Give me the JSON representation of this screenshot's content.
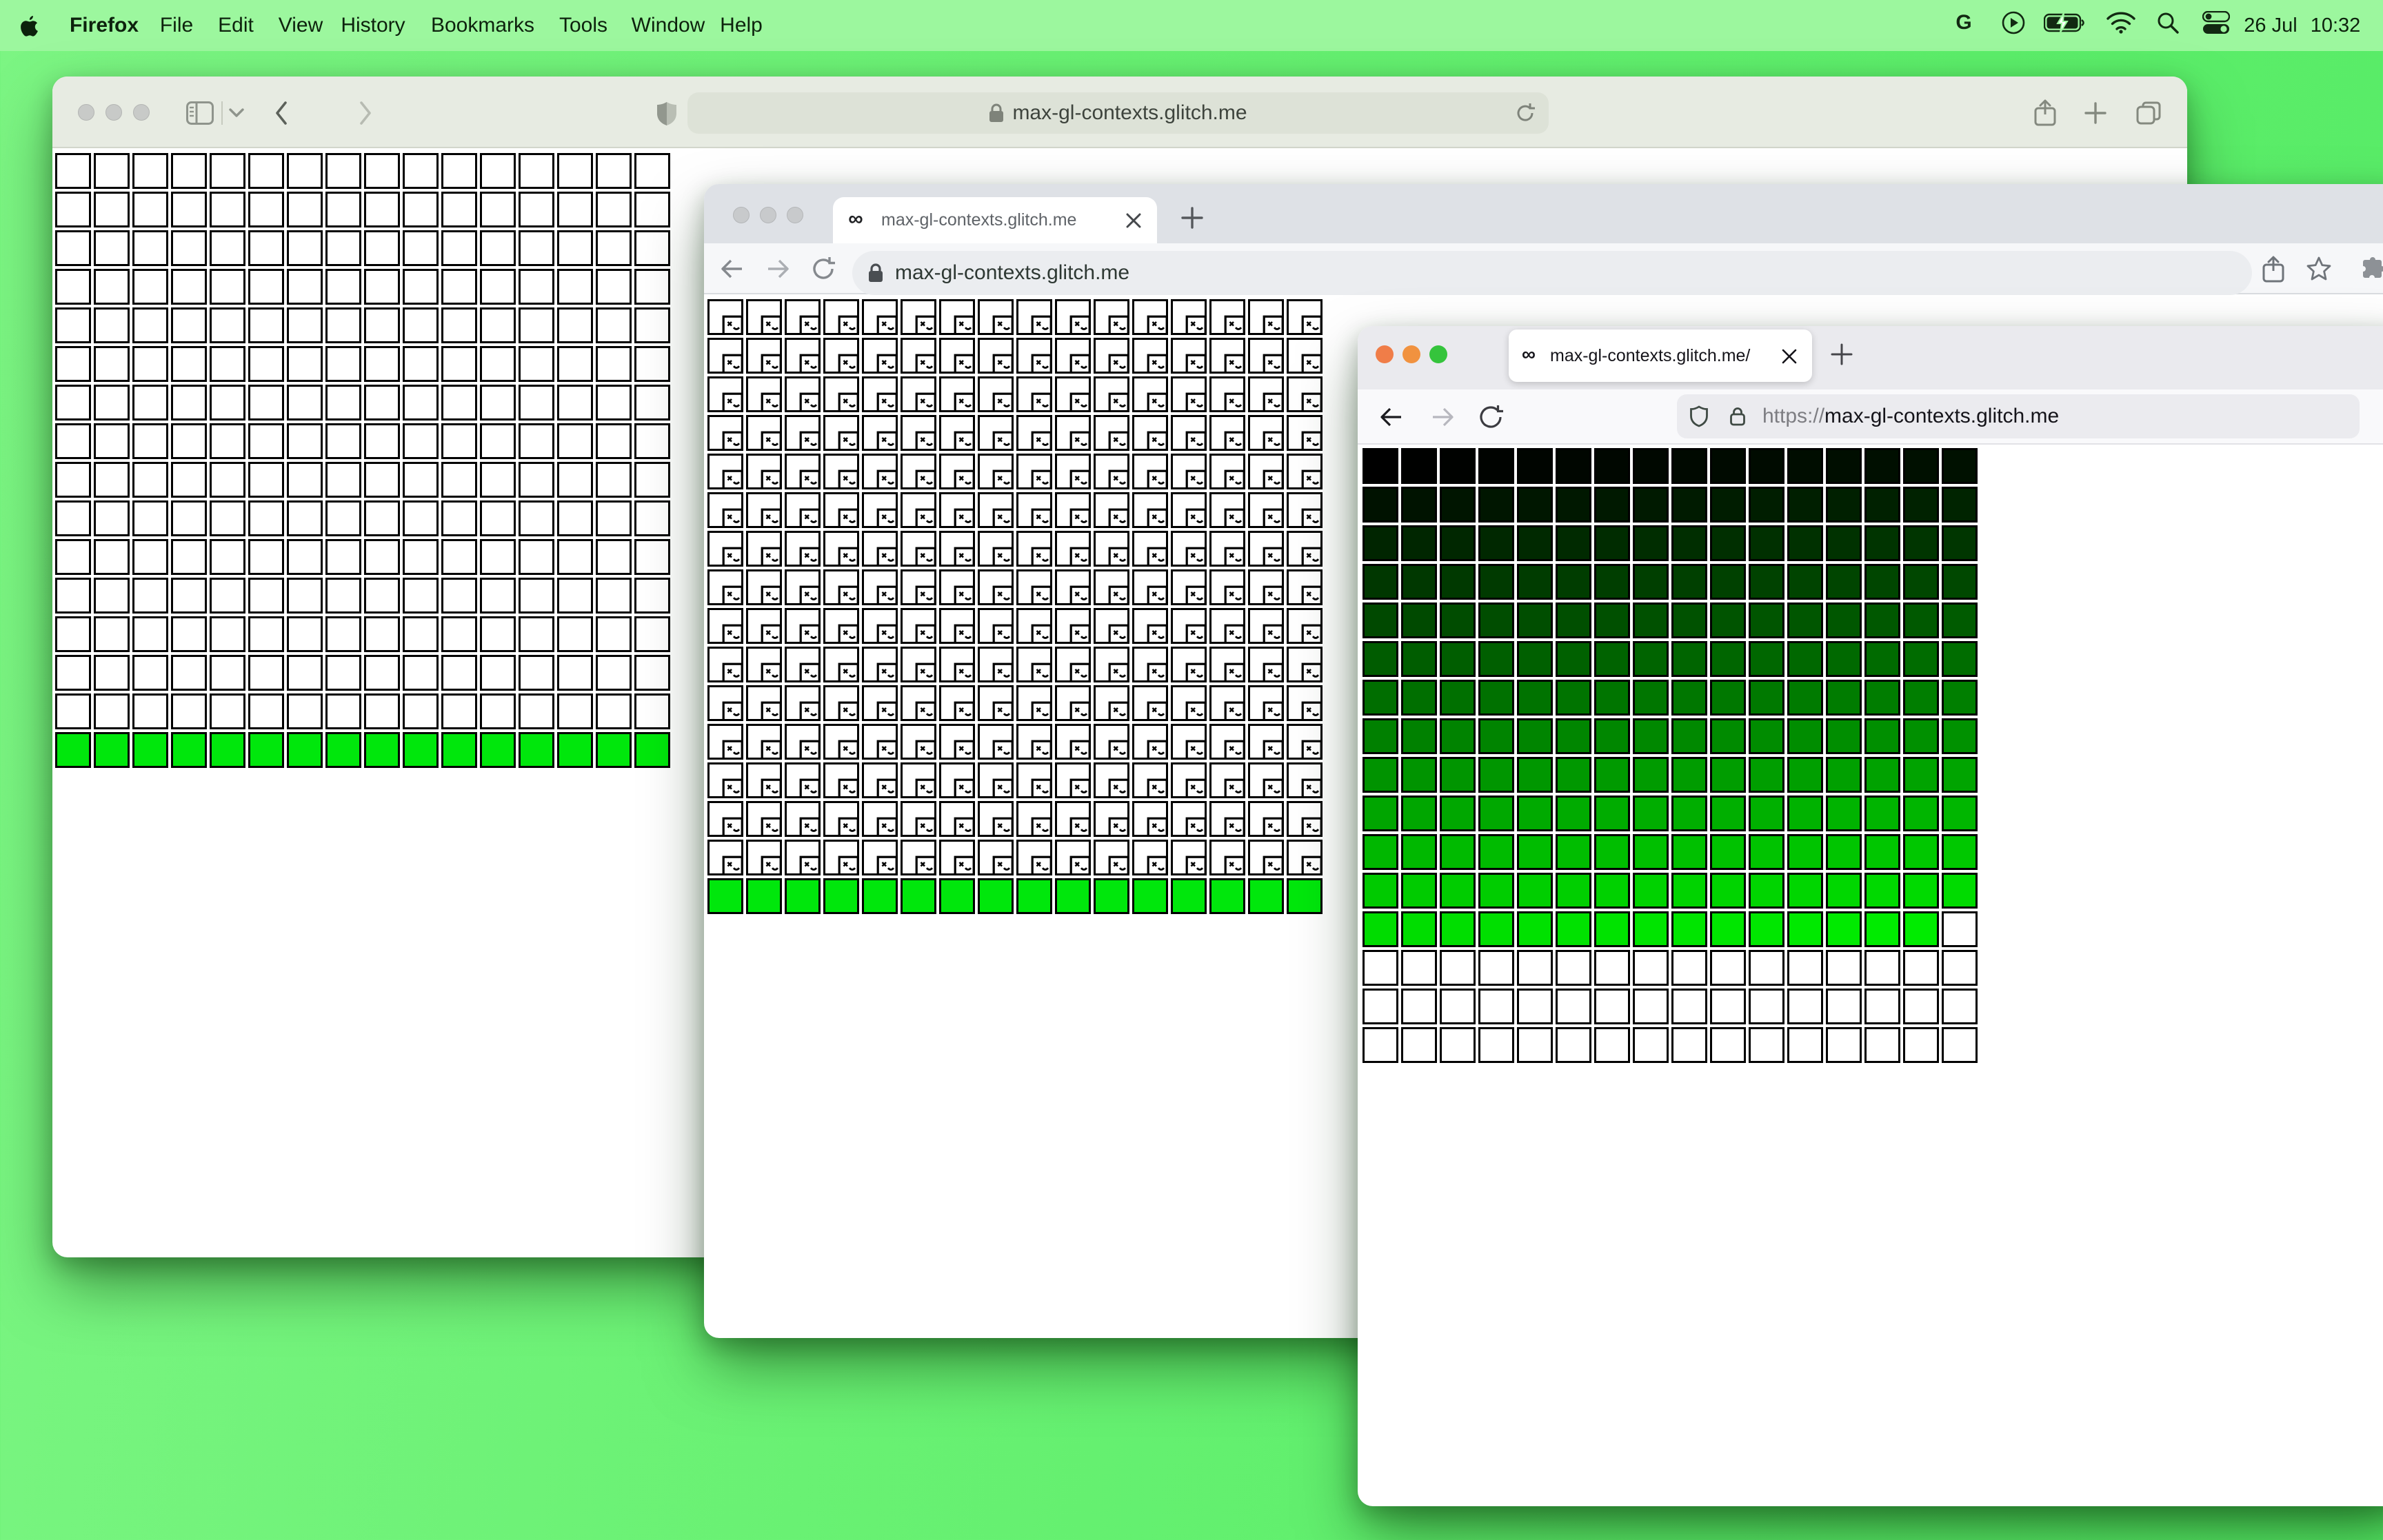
{
  "menu_bar": {
    "apple_icon": "apple-logo",
    "app_name": "Firefox",
    "items": [
      "File",
      "Edit",
      "View",
      "History",
      "Bookmarks",
      "Tools",
      "Window",
      "Help"
    ],
    "status_icons": [
      "google-g",
      "play-circle",
      "battery-charging",
      "wifi",
      "search",
      "control-center"
    ],
    "date": "26 Jul",
    "time": "10:32"
  },
  "desktop": {
    "background_color": "#5fee6c"
  },
  "safari_window": {
    "browser": "Safari",
    "active": false,
    "url": "max-gl-contexts.glitch.me",
    "toolbar_icons": [
      "sidebar",
      "chevron-down",
      "back",
      "forward",
      "privacy-shield",
      "lock",
      "reload",
      "share",
      "new-tab-plus",
      "tab-overview"
    ],
    "grid": {
      "columns": 16,
      "rows": 16,
      "white_rows": 15,
      "green_cells": 16,
      "green_color": "#00e70c",
      "border_color": "#000000"
    }
  },
  "chrome_window": {
    "browser": "Chrome",
    "active": false,
    "tab_title": "max-gl-contexts.glitch.me",
    "url": "max-gl-contexts.glitch.me",
    "toolbar_icons": [
      "back",
      "forward",
      "reload",
      "lock",
      "share",
      "bookmark-star",
      "extensions-puzzle"
    ],
    "grid": {
      "columns": 16,
      "rows": 16,
      "white_rows": 15,
      "green_cells": 16,
      "green_color": "#00e70c",
      "border_color": "#000000",
      "placeholder_icon": "sad-canvas-face"
    }
  },
  "firefox_window": {
    "browser": "Firefox",
    "active": true,
    "tab_title": "max-gl-contexts.glitch.me/",
    "url_scheme": "https://",
    "url_host": "max-gl-contexts.glitch.me",
    "toolbar_icons": [
      "back",
      "forward",
      "reload",
      "tracking-shield",
      "lock",
      "new-tab-plus",
      "close-tab"
    ],
    "grid": {
      "columns": 16,
      "rows": 16,
      "colored_cells": 207,
      "white_cells": 49,
      "gradient_from_color": "rgb(0,0,0)",
      "gradient_to_color": "rgb(0,236,0)",
      "border_color": "#000000"
    }
  },
  "traffic_lights": {
    "inactive_fill": "#c8cac8",
    "close_color": "#f07d48",
    "minimize_color": "#f1923f",
    "zoom_color": "#35c43c"
  }
}
